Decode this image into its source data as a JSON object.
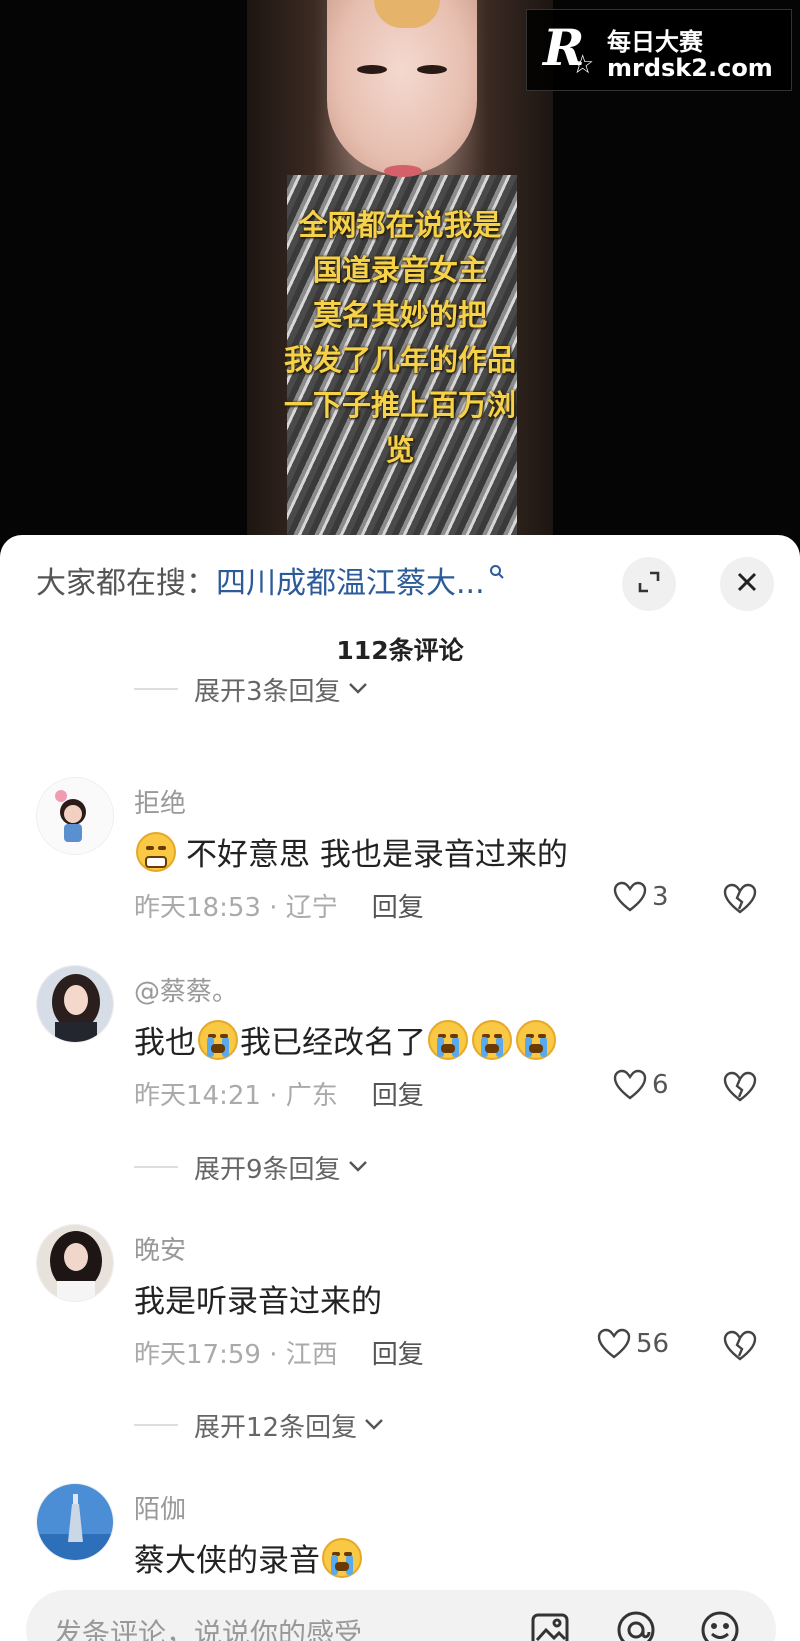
{
  "video": {
    "overlay_lines": [
      "全网都在说我是",
      "国道录音女主",
      "莫名其妙的把",
      "我发了几年的作品",
      "一下子推上百万浏",
      "览"
    ],
    "watermark": {
      "cn": "每日大赛",
      "url": "mrdsk2.com",
      "mark": "R"
    }
  },
  "sheet": {
    "search_prefix": "大家都在搜：",
    "search_link": "四川成都温江蔡大...",
    "comment_count": "112条评论",
    "expand_replies": [
      "展开3条回复",
      "展开9条回复",
      "展开12条回复"
    ],
    "comments": [
      {
        "username": "拒绝",
        "text": "不好意思 我也是录音过来的",
        "time": "昨天18:53 · 辽宁",
        "reply": "回复",
        "likes": "3"
      },
      {
        "username": "@蔡蔡。",
        "text_a": "我也",
        "text_b": "我已经改名了",
        "time": "昨天14:21 · 广东",
        "reply": "回复",
        "likes": "6"
      },
      {
        "username": "晚安",
        "text": "我是听录音过来的",
        "time": "昨天17:59 · 江西",
        "reply": "回复",
        "likes": "56"
      },
      {
        "username": "陌伽",
        "text": "蔡大侠的录音"
      }
    ],
    "input_placeholder": "发条评论，说说你的感受",
    "icons": [
      "expand-icon",
      "close-icon",
      "heart-icon",
      "broken-heart-icon",
      "image-icon",
      "at-icon",
      "emoji-icon"
    ]
  }
}
